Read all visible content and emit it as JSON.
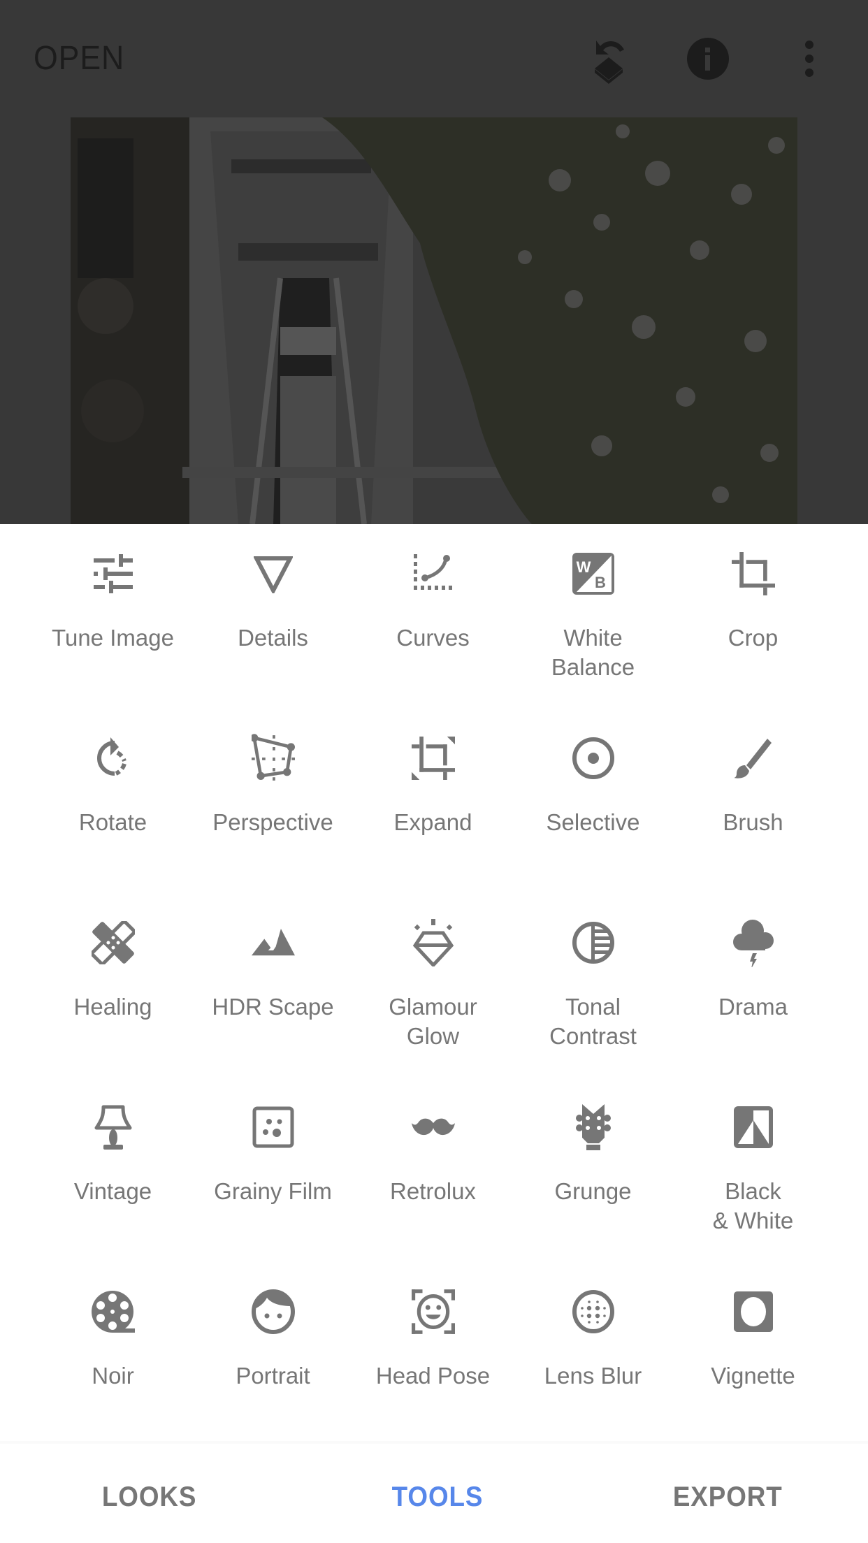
{
  "topbar": {
    "open_label": "OPEN",
    "icons": [
      "undo-stack-icon",
      "info-icon",
      "more-vert-icon"
    ]
  },
  "photo": {
    "description": "Dimmed photo of the Eiffel Tower seen between a building and trees"
  },
  "tools": [
    {
      "label": "Tune Image",
      "icon": "tune-icon"
    },
    {
      "label": "Details",
      "icon": "details-icon"
    },
    {
      "label": "Curves",
      "icon": "curves-icon"
    },
    {
      "label": "White\nBalance",
      "icon": "white-balance-icon"
    },
    {
      "label": "Crop",
      "icon": "crop-icon"
    },
    {
      "label": "Rotate",
      "icon": "rotate-icon"
    },
    {
      "label": "Perspective",
      "icon": "perspective-icon"
    },
    {
      "label": "Expand",
      "icon": "expand-icon"
    },
    {
      "label": "Selective",
      "icon": "selective-icon"
    },
    {
      "label": "Brush",
      "icon": "brush-icon"
    },
    {
      "label": "Healing",
      "icon": "healing-icon"
    },
    {
      "label": "HDR Scape",
      "icon": "hdr-scape-icon"
    },
    {
      "label": "Glamour\nGlow",
      "icon": "glamour-glow-icon"
    },
    {
      "label": "Tonal\nContrast",
      "icon": "tonal-contrast-icon"
    },
    {
      "label": "Drama",
      "icon": "drama-icon"
    },
    {
      "label": "Vintage",
      "icon": "vintage-icon"
    },
    {
      "label": "Grainy Film",
      "icon": "grainy-film-icon"
    },
    {
      "label": "Retrolux",
      "icon": "retrolux-icon"
    },
    {
      "label": "Grunge",
      "icon": "grunge-icon"
    },
    {
      "label": "Black\n& White",
      "icon": "black-white-icon"
    },
    {
      "label": "Noir",
      "icon": "noir-icon"
    },
    {
      "label": "Portrait",
      "icon": "portrait-icon"
    },
    {
      "label": "Head Pose",
      "icon": "head-pose-icon"
    },
    {
      "label": "Lens Blur",
      "icon": "lens-blur-icon"
    },
    {
      "label": "Vignette",
      "icon": "vignette-icon"
    }
  ],
  "bottom_nav": {
    "items": [
      {
        "label": "LOOKS",
        "active": false
      },
      {
        "label": "TOOLS",
        "active": true
      },
      {
        "label": "EXPORT",
        "active": false
      }
    ],
    "active_color": "#5787ea",
    "inactive_color": "#767676"
  },
  "colors": {
    "icon_gray": "#767676",
    "dim_overlay_bg": "#383838",
    "topbar_icon": "#1c1c1c"
  }
}
